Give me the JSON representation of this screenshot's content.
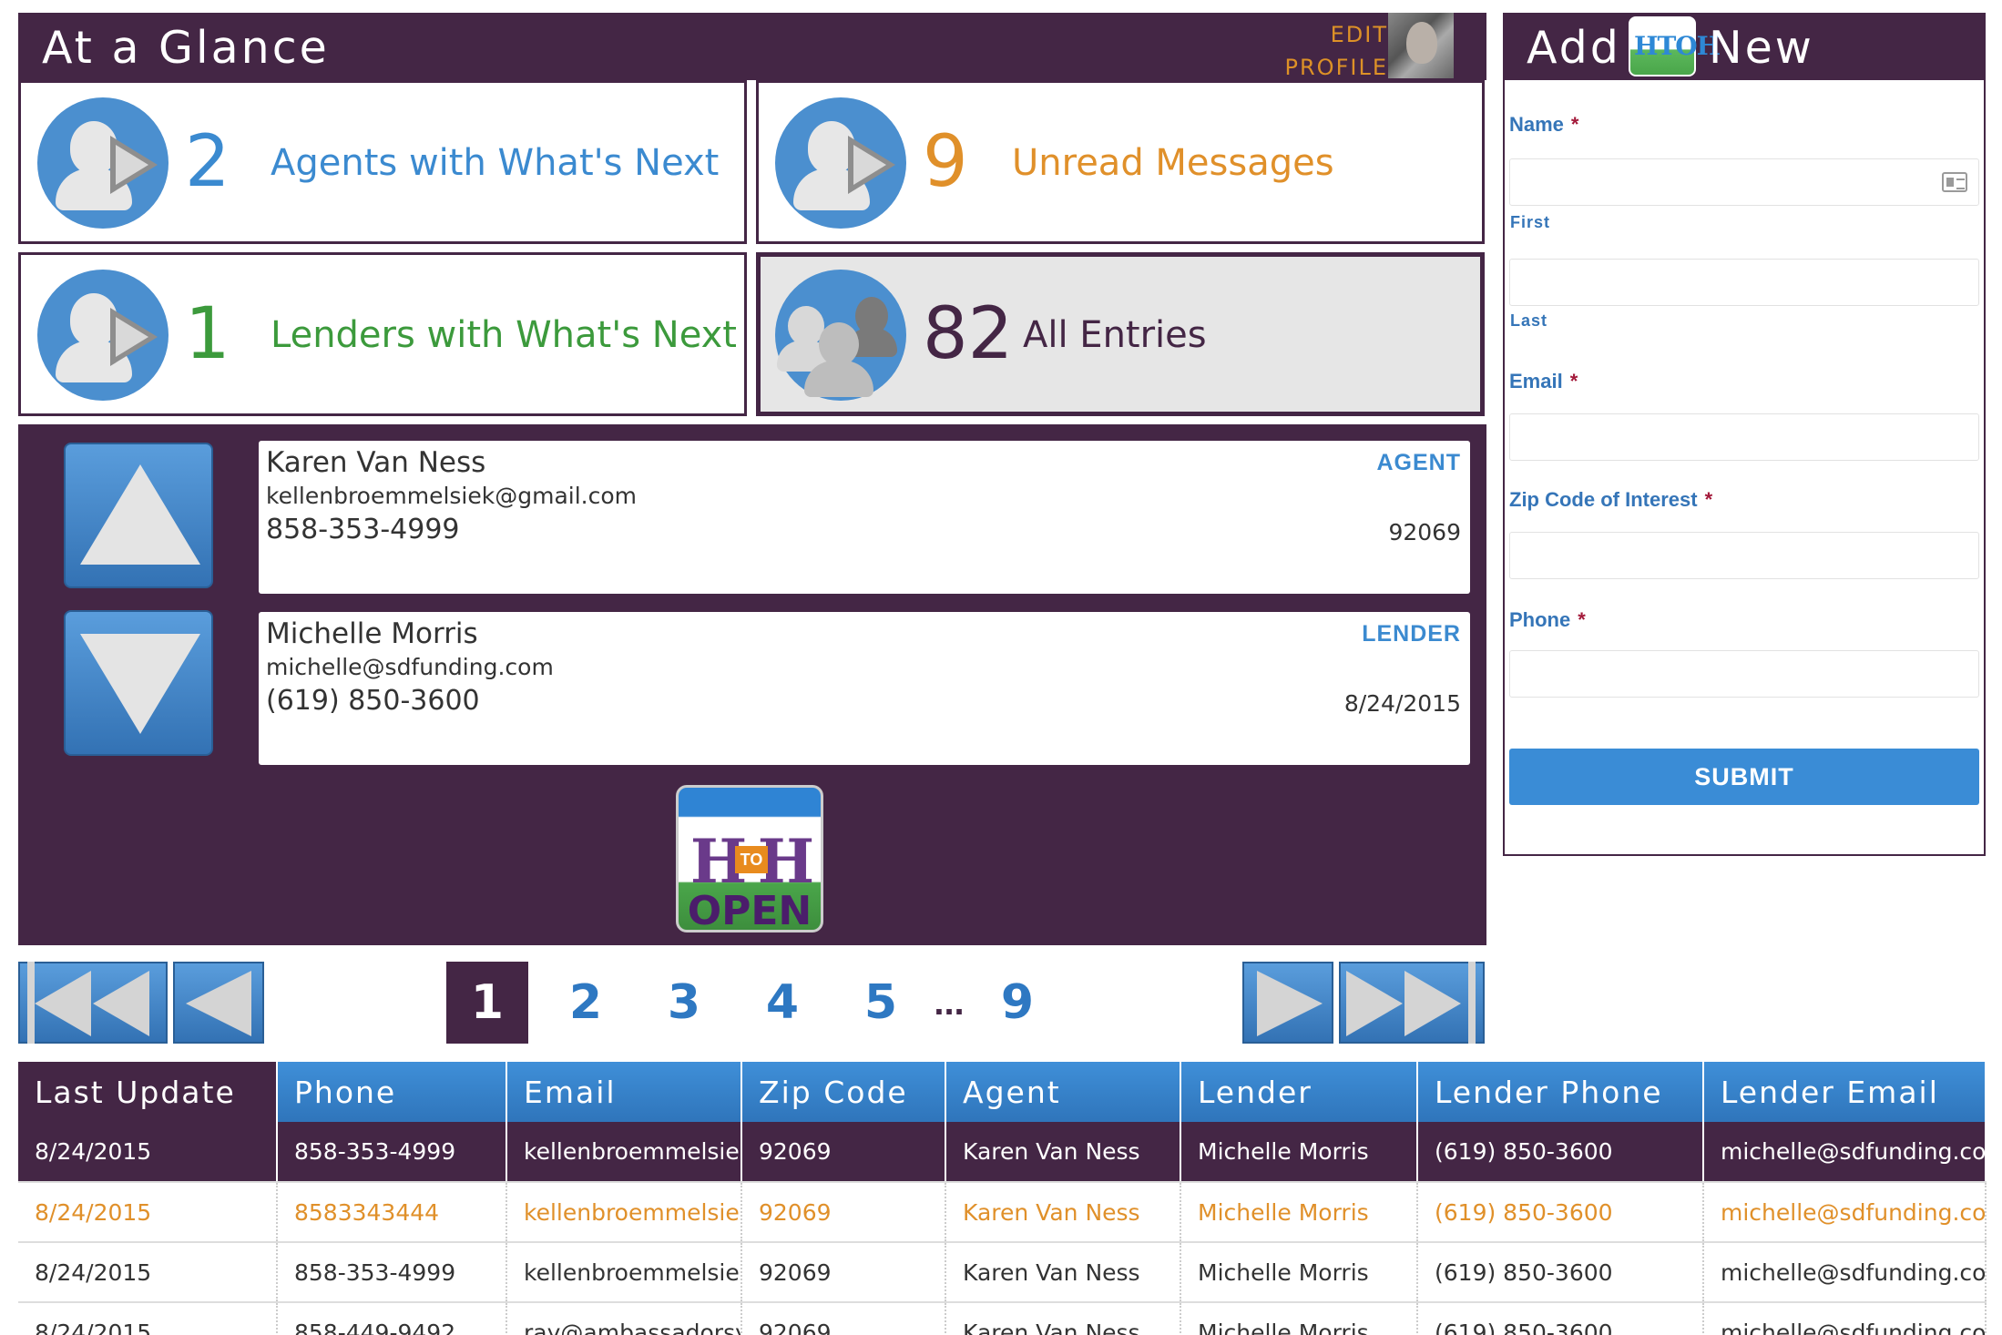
{
  "glance": {
    "title": "At a Glance",
    "edit_label": "EDIT",
    "profile_label": "PROFILE"
  },
  "tiles": [
    {
      "count": "2",
      "label": "Agents with What's Next",
      "color": "#3b8ad0"
    },
    {
      "count": "9",
      "label": "Unread Messages",
      "color": "#e0902a"
    },
    {
      "count": "1",
      "label": "Lenders with What's Next",
      "color": "#3c9a3c"
    },
    {
      "count": "82",
      "label": "All Entries",
      "color": "#442645"
    }
  ],
  "entries": [
    {
      "name": "Karen Van Ness",
      "email": "kellenbroemmelsiek@gmail.com",
      "phone": "858-353-4999",
      "role": "AGENT",
      "meta": "92069"
    },
    {
      "name": "Michelle Morris",
      "email": "michelle@sdfunding.com",
      "phone": "(619) 850-3600",
      "role": "LENDER",
      "meta": "8/24/2015"
    }
  ],
  "logo": {
    "h1": "H",
    "to": "TO",
    "h2": "H",
    "open": "OPEN"
  },
  "pagination": {
    "pages": [
      "1",
      "2",
      "3",
      "4",
      "5",
      "9"
    ],
    "current": "1",
    "ellipsis": "..."
  },
  "table": {
    "columns": [
      "Last Update",
      "Phone",
      "Email",
      "Zip Code",
      "Agent",
      "Lender",
      "Lender Phone",
      "Lender Email"
    ],
    "rows": [
      [
        "8/24/2015",
        "858-353-4999",
        "kellenbroemmelsiek",
        "92069",
        "Karen Van Ness",
        "Michelle Morris",
        "(619) 850-3600",
        "michelle@sdfunding.com"
      ],
      [
        "8/24/2015",
        "8583343444",
        "kellenbroemmelsiek",
        "92069",
        "Karen Van Ness",
        "Michelle Morris",
        "(619) 850-3600",
        "michelle@sdfunding.com"
      ],
      [
        "8/24/2015",
        "858-353-4999",
        "kellenbroemmelsiek",
        "92069",
        "Karen Van Ness",
        "Michelle Morris",
        "(619) 850-3600",
        "michelle@sdfunding.com"
      ],
      [
        "8/24/2015",
        "858-449-9492",
        "ray@ambassadorsys",
        "92069",
        "Karen Van Ness",
        "Michelle Morris",
        "(619) 850-3600",
        "michelle@sdfunding.com"
      ]
    ]
  },
  "add_new": {
    "title_start": "Add",
    "title_end": "New",
    "logo_text": "HTOH",
    "name_label": "Name",
    "first_label": "First",
    "last_label": "Last",
    "email_label": "Email",
    "zip_label": "Zip Code of Interest",
    "phone_label": "Phone",
    "required_mark": "*",
    "submit_label": "SUBMIT"
  },
  "colors": {
    "brand_purple": "#442645",
    "brand_blue": "#3b8ad0",
    "accent_orange": "#e0902a",
    "accent_green": "#3c9a3c"
  },
  "icons": [
    "user-play-icon",
    "group-icon",
    "arrow-up-icon",
    "arrow-down-icon",
    "first-page-icon",
    "prev-page-icon",
    "next-page-icon",
    "last-page-icon",
    "contact-card-icon"
  ]
}
